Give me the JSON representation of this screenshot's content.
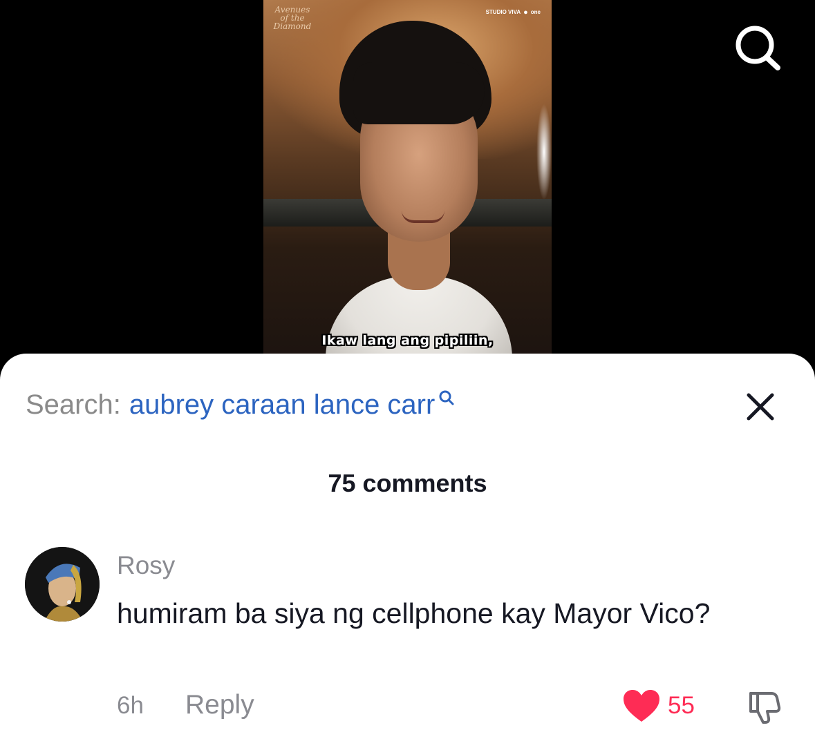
{
  "video": {
    "logo_left": "Avenues of the Diamond",
    "logo_right_studio": "STUDIO VIVA",
    "logo_right_one": "one",
    "subtitle": "Ikaw lang ang pipiliin,"
  },
  "header": {
    "search_icon": "search-icon"
  },
  "sheet": {
    "search_prefix": "Search:",
    "search_query": "aubrey caraan lance carr",
    "search_icon": "search-icon",
    "close_icon": "close-icon",
    "comments_count": "75 comments"
  },
  "comment": {
    "author": "Rosy",
    "text": "humiram ba siya ng cellphone kay Mayor Vico?",
    "time": "6h",
    "reply_label": "Reply",
    "likes": "55",
    "like_icon": "heart-icon",
    "dislike_icon": "thumbs-down-icon"
  },
  "colors": {
    "accent_blue": "#2c64c0",
    "like_red": "#fe2c55",
    "muted_gray": "#8a8b91",
    "text_dark": "#161823"
  }
}
